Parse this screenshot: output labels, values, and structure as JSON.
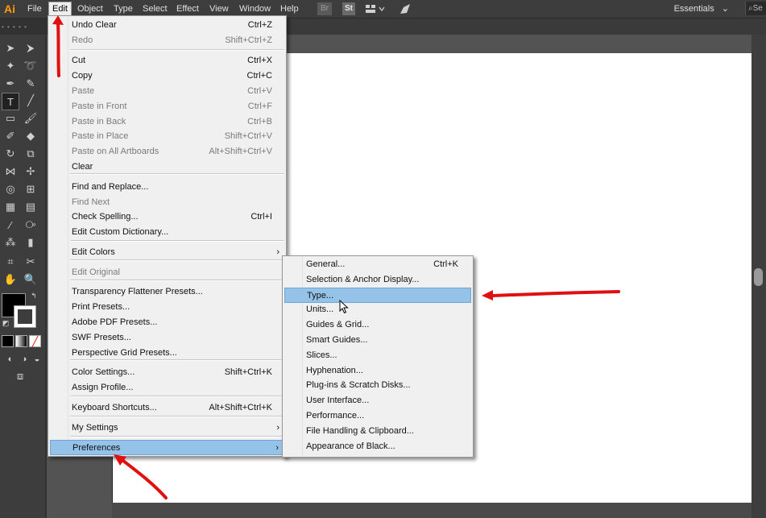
{
  "app": {
    "logo": "Ai",
    "workspace": "Essentials",
    "search_stub": "Se"
  },
  "menubar": {
    "items": [
      "File",
      "Edit",
      "Object",
      "Type",
      "Select",
      "Effect",
      "View",
      "Window",
      "Help"
    ],
    "active_item": "Edit",
    "toolbar_buttons": [
      "Br",
      "St"
    ]
  },
  "edit_menu": {
    "items": [
      {
        "label": "Undo Clear",
        "shortcut": "Ctrl+Z",
        "disabled": false
      },
      {
        "label": "Redo",
        "shortcut": "Shift+Ctrl+Z",
        "disabled": true
      },
      {
        "label": "Cut",
        "shortcut": "Ctrl+X",
        "disabled": false
      },
      {
        "label": "Copy",
        "shortcut": "Ctrl+C",
        "disabled": false
      },
      {
        "label": "Paste",
        "shortcut": "Ctrl+V",
        "disabled": true
      },
      {
        "label": "Paste in Front",
        "shortcut": "Ctrl+F",
        "disabled": true
      },
      {
        "label": "Paste in Back",
        "shortcut": "Ctrl+B",
        "disabled": true
      },
      {
        "label": "Paste in Place",
        "shortcut": "Shift+Ctrl+V",
        "disabled": true
      },
      {
        "label": "Paste on All Artboards",
        "shortcut": "Alt+Shift+Ctrl+V",
        "disabled": true
      },
      {
        "label": "Clear",
        "shortcut": "",
        "disabled": false
      },
      {
        "label": "Find and Replace...",
        "shortcut": "",
        "disabled": false
      },
      {
        "label": "Find Next",
        "shortcut": "",
        "disabled": true
      },
      {
        "label": "Check Spelling...",
        "shortcut": "Ctrl+I",
        "disabled": false
      },
      {
        "label": "Edit Custom Dictionary...",
        "shortcut": "",
        "disabled": false
      },
      {
        "label": "Edit Colors",
        "shortcut": "",
        "disabled": false,
        "submenu": true
      },
      {
        "label": "Edit Original",
        "shortcut": "",
        "disabled": true
      },
      {
        "label": "Transparency Flattener Presets...",
        "shortcut": "",
        "disabled": false
      },
      {
        "label": "Print Presets...",
        "shortcut": "",
        "disabled": false
      },
      {
        "label": "Adobe PDF Presets...",
        "shortcut": "",
        "disabled": false
      },
      {
        "label": "SWF Presets...",
        "shortcut": "",
        "disabled": false
      },
      {
        "label": "Perspective Grid Presets...",
        "shortcut": "",
        "disabled": false
      },
      {
        "label": "Color Settings...",
        "shortcut": "Shift+Ctrl+K",
        "disabled": false
      },
      {
        "label": "Assign Profile...",
        "shortcut": "",
        "disabled": false
      },
      {
        "label": "Keyboard Shortcuts...",
        "shortcut": "Alt+Shift+Ctrl+K",
        "disabled": false
      },
      {
        "label": "My Settings",
        "shortcut": "",
        "disabled": false,
        "submenu": true
      },
      {
        "label": "Preferences",
        "shortcut": "",
        "disabled": false,
        "submenu": true,
        "highlighted": true
      }
    ]
  },
  "preferences_menu": {
    "items": [
      {
        "label": "General...",
        "shortcut": "Ctrl+K"
      },
      {
        "label": "Selection & Anchor Display...",
        "shortcut": ""
      },
      {
        "label": "Type...",
        "shortcut": "",
        "highlighted": true
      },
      {
        "label": "Units...",
        "shortcut": ""
      },
      {
        "label": "Guides & Grid...",
        "shortcut": ""
      },
      {
        "label": "Smart Guides...",
        "shortcut": ""
      },
      {
        "label": "Slices...",
        "shortcut": ""
      },
      {
        "label": "Hyphenation...",
        "shortcut": ""
      },
      {
        "label": "Plug-ins & Scratch Disks...",
        "shortcut": ""
      },
      {
        "label": "User Interface...",
        "shortcut": ""
      },
      {
        "label": "Performance...",
        "shortcut": ""
      },
      {
        "label": "File Handling & Clipboard...",
        "shortcut": ""
      },
      {
        "label": "Appearance of Black...",
        "shortcut": ""
      }
    ]
  },
  "colors": {
    "menubar_bg": "#3d3d3d",
    "menu_bg": "#f0f0f0",
    "highlight": "#95c2e8",
    "annotation_red": "#e01010",
    "logo_orange": "#ff9a00"
  }
}
